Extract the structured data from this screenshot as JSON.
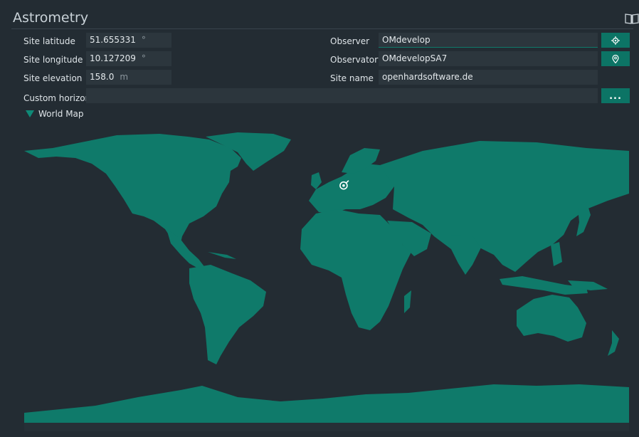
{
  "panel": {
    "title": "Astrometry",
    "book_icon": "book-open-icon"
  },
  "site": {
    "latitude_label": "Site latitude",
    "latitude_value": "51.655331",
    "latitude_unit": "°",
    "longitude_label": "Site longitude",
    "longitude_value": "10.127209",
    "longitude_unit": "°",
    "elevation_label": "Site elevation",
    "elevation_value": "158.0",
    "elevation_unit": "m"
  },
  "observer": {
    "observer_label": "Observer",
    "observer_value": "OMdevelop",
    "observatory_label": "Observatory",
    "observatory_value": "OMdevelopSA7",
    "site_name_label": "Site name",
    "site_name_value": "openhardsoftware.de"
  },
  "horizon": {
    "label": "Custom horizon",
    "value": "",
    "browse_label": "..."
  },
  "world_map": {
    "toggle_label": "World Map",
    "expanded": true,
    "marker_longitude": 10.127209,
    "marker_latitude": 51.655331
  },
  "colors": {
    "background": "#232c33",
    "land": "#0f7a6a",
    "accent": "#0c7465",
    "field": "#2c363d"
  }
}
